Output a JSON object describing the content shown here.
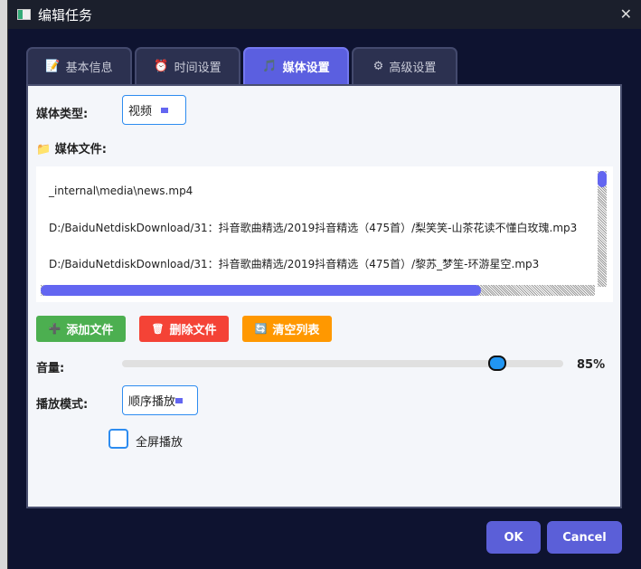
{
  "window": {
    "title": "编辑任务"
  },
  "tabs": [
    {
      "label": "基本信息",
      "icon": "📝"
    },
    {
      "label": "时间设置",
      "icon": "⏰"
    },
    {
      "label": "媒体设置",
      "icon": "🎵"
    },
    {
      "label": "高级设置",
      "icon": "⚙"
    }
  ],
  "media_type": {
    "label": "媒体类型:",
    "value": "视频"
  },
  "media_files": {
    "label": "媒体文件:",
    "icon": "📁",
    "items": [
      "_internal\\media\\news.mp4",
      "D:/BaiduNetdiskDownload/31：抖音歌曲精选/2019抖音精选（475首）/梨笑笑-山茶花读不懂白玫瑰.mp3",
      "D:/BaiduNetdiskDownload/31：抖音歌曲精选/2019抖音精选（475首）/黎苏_梦笙-环游星空.mp3"
    ]
  },
  "buttons": {
    "add": "添加文件",
    "add_icon": "➕",
    "delete": "删除文件",
    "delete_icon": "🗑",
    "clear": "清空列表",
    "clear_icon": "🔄"
  },
  "volume": {
    "label": "音量:",
    "value": 85,
    "text": "85%"
  },
  "play_mode": {
    "label": "播放模式:",
    "value": "顺序播放"
  },
  "fullscreen": {
    "label": "全屏播放",
    "checked": false
  },
  "dialog": {
    "ok": "OK",
    "cancel": "Cancel"
  },
  "colors": {
    "accent": "#6366f1",
    "add": "#4caf50",
    "delete": "#f44336",
    "clear": "#ff9800"
  }
}
